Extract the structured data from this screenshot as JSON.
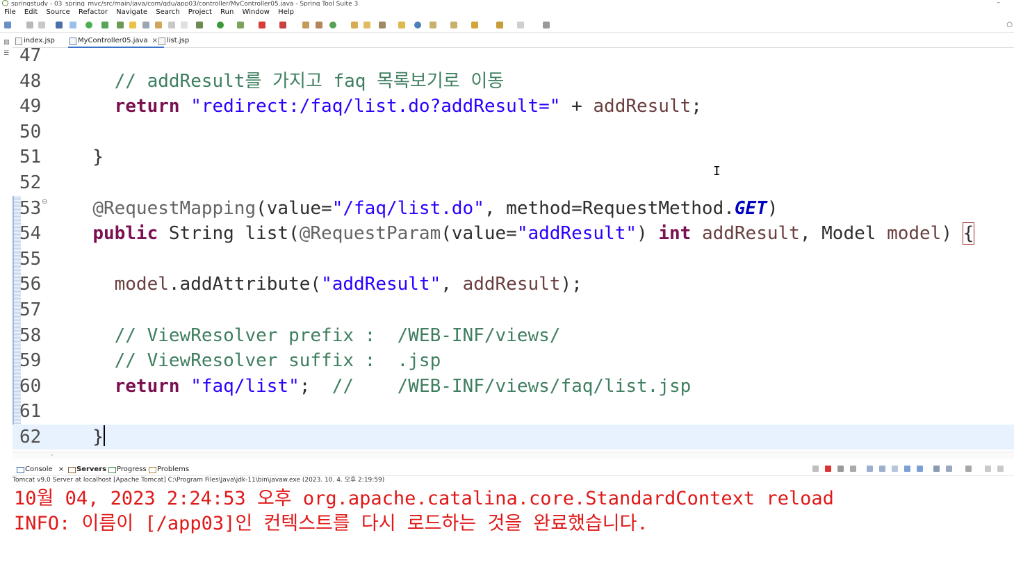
{
  "window": {
    "title": "springstudy - 03_spring_mvc/src/main/java/com/gdu/app03/controller/MyController05.java - Spring Tool Suite 3",
    "minimize_glyph": "–"
  },
  "menu": [
    "File",
    "Edit",
    "Source",
    "Refactor",
    "Navigate",
    "Search",
    "Project",
    "Run",
    "Window",
    "Help"
  ],
  "tabs": [
    {
      "label": "index.jsp",
      "active": false
    },
    {
      "label": "MyController05.java",
      "active": true,
      "close": "×"
    },
    {
      "label": "list.jsp",
      "active": false
    }
  ],
  "editor": {
    "lines": [
      {
        "num": "47",
        "tokens": []
      },
      {
        "num": "48",
        "tokens": [
          {
            "t": "    ",
            "c": ""
          },
          {
            "t": "// addResult를 가지고 faq 목록보기로 이동",
            "c": "cmt"
          }
        ]
      },
      {
        "num": "49",
        "tokens": [
          {
            "t": "    ",
            "c": ""
          },
          {
            "t": "return",
            "c": "kw"
          },
          {
            "t": " ",
            "c": ""
          },
          {
            "t": "\"redirect:/faq/list.do?addResult=\"",
            "c": "str"
          },
          {
            "t": " + ",
            "c": ""
          },
          {
            "t": "addResult",
            "c": "var"
          },
          {
            "t": ";",
            "c": ""
          }
        ]
      },
      {
        "num": "50",
        "tokens": []
      },
      {
        "num": "51",
        "tokens": [
          {
            "t": "  }",
            "c": ""
          }
        ]
      },
      {
        "num": "52",
        "tokens": []
      },
      {
        "num": "53",
        "fold": "⊖",
        "tokens": [
          {
            "t": "  ",
            "c": ""
          },
          {
            "t": "@RequestMapping",
            "c": "ann"
          },
          {
            "t": "(value=",
            "c": ""
          },
          {
            "t": "\"/faq/list.do\"",
            "c": "str"
          },
          {
            "t": ", method=RequestMethod.",
            "c": ""
          },
          {
            "t": "GET",
            "c": "cst"
          },
          {
            "t": ")",
            "c": ""
          }
        ]
      },
      {
        "num": "54",
        "tokens": [
          {
            "t": "  ",
            "c": ""
          },
          {
            "t": "public",
            "c": "kw"
          },
          {
            "t": " String list(",
            "c": ""
          },
          {
            "t": "@RequestParam",
            "c": "ann"
          },
          {
            "t": "(value=",
            "c": ""
          },
          {
            "t": "\"addResult\"",
            "c": "str"
          },
          {
            "t": ") ",
            "c": ""
          },
          {
            "t": "int",
            "c": "kw"
          },
          {
            "t": " ",
            "c": ""
          },
          {
            "t": "addResult",
            "c": "var"
          },
          {
            "t": ", Model ",
            "c": ""
          },
          {
            "t": "model",
            "c": "var"
          },
          {
            "t": ") ",
            "c": ""
          },
          {
            "t": "{",
            "c": "brk"
          }
        ]
      },
      {
        "num": "55",
        "tokens": []
      },
      {
        "num": "56",
        "tokens": [
          {
            "t": "    ",
            "c": ""
          },
          {
            "t": "model",
            "c": "var"
          },
          {
            "t": ".addAttribute(",
            "c": ""
          },
          {
            "t": "\"addResult\"",
            "c": "str"
          },
          {
            "t": ", ",
            "c": ""
          },
          {
            "t": "addResult",
            "c": "var"
          },
          {
            "t": ");",
            "c": ""
          }
        ]
      },
      {
        "num": "57",
        "tokens": []
      },
      {
        "num": "58",
        "tokens": [
          {
            "t": "    ",
            "c": ""
          },
          {
            "t": "// ViewResolver prefix :  /WEB-INF/views/",
            "c": "cmt"
          }
        ]
      },
      {
        "num": "59",
        "tokens": [
          {
            "t": "    ",
            "c": ""
          },
          {
            "t": "// ViewResolver suffix :  .jsp",
            "c": "cmt"
          }
        ]
      },
      {
        "num": "60",
        "tokens": [
          {
            "t": "    ",
            "c": ""
          },
          {
            "t": "return",
            "c": "kw"
          },
          {
            "t": " ",
            "c": ""
          },
          {
            "t": "\"faq/list\"",
            "c": "str"
          },
          {
            "t": ";  ",
            "c": ""
          },
          {
            "t": "//    /WEB-INF/views/faq/list.jsp",
            "c": "cmt"
          }
        ]
      },
      {
        "num": "61",
        "tokens": []
      },
      {
        "num": "62",
        "current": true,
        "caret": true,
        "tokens": [
          {
            "t": "  }",
            "c": ""
          }
        ]
      }
    ]
  },
  "console": {
    "tabs": [
      {
        "label": "Console",
        "close": "×",
        "bold": false
      },
      {
        "label": "Servers",
        "bold": true
      },
      {
        "label": "Progress",
        "bold": false
      },
      {
        "label": "Problems",
        "bold": false
      }
    ],
    "info": "Tomcat v9.0 Server at localhost [Apache Tomcat] C:\\Program Files\\Java\\jdk-11\\bin\\javaw.exe  (2023. 10. 4. 오후 2:19:59)",
    "output": [
      "10월 04, 2023 2:24:53 오후 org.apache.catalina.core.StandardContext reload",
      "INFO: 이름이 [/app03]인 컨텍스트를 다시 로드하는 것을 완료했습니다."
    ]
  },
  "colors": {
    "keyword": "#7a1151",
    "string": "#2a00ff",
    "comment": "#3f7f5f",
    "annotation": "#646464",
    "console_text": "#e01818",
    "current_line": "#e8f2fe"
  }
}
